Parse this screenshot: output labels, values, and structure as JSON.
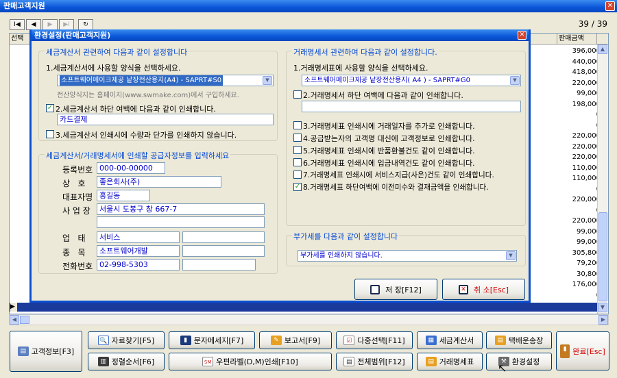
{
  "window": {
    "title": "판매고객지원",
    "close": "✕"
  },
  "nav": {
    "first": "I◀",
    "prev": "◀",
    "next": "▶",
    "last": "▶I",
    "refresh": "↻",
    "count": "39 / 39"
  },
  "grid": {
    "headers": [
      "선택",
      "판매금액"
    ],
    "amounts": [
      "396,000",
      "440,000",
      "418,000",
      "220,000",
      "99,000",
      "198,000",
      "0",
      "0",
      "220,000",
      "220,000",
      "220,000",
      "110,000",
      "110,000",
      "0",
      "220,000",
      "0",
      "220,000",
      "99,000",
      "99,000",
      "305,800",
      "79,200",
      "30,800",
      "176,000",
      "0",
      "99,000"
    ],
    "row_arrow": "▶"
  },
  "dialog": {
    "title": "환경설정(판매고객지원)",
    "close": "✕",
    "tax": {
      "group_title": "세금계산서 관련하여 다음과 같이 설정합니다",
      "q1": "1.세금계산서에 사용할 양식을 선택하세요.",
      "q1_value": "소프트웨어메이크제공 낱장전산용지(A4)      - SAPRT#S0",
      "q1_note": "전산양식지는 홈페이지(www.swmake.com)에서 구입하세요.",
      "q2": "2.세금계산서 하단 여백에 다음과 같이 인쇄합니다.",
      "q2_checked": true,
      "q2_value": "카드결제",
      "q3": "3.세금계산서 인쇄시에 수량과 단가를 인쇄하지 않습니다.",
      "q3_checked": false
    },
    "supplier": {
      "group_title": "세금계산서/거래명세서에 인쇄할 공급자정보를 입력하세요",
      "reg_label": "등록번호",
      "reg_value": "000-00-00000",
      "name_label": "상   호",
      "name_value": "좋은회사(주)",
      "rep_label": "대표자명",
      "rep_value": "홍길동",
      "addr_label": "사 업 장",
      "addr_value": "서울시 도봉구 창 667-7",
      "biz_label": "업   태",
      "biz_value": "서비스",
      "item_label": "종   목",
      "item_value": "소프트웨어개발",
      "tel_label": "전화번호",
      "tel_value": "02-998-5303"
    },
    "stmt": {
      "group_title": "거래명세서 관련하여 다음과 같이 설정합니다.",
      "q1": "1.거래명세표에 사용할 양식을 선택하세요.",
      "q1_value": "소프트웨어메이크제공 낱장전산용지( A4 )   - SAPRT#G0",
      "q2": "2.거래명세서 하단 여백에 다음과 같이 인쇄합니다.",
      "q2_value": "",
      "options": [
        {
          "label": "3.거래명세표 인쇄시에 거래일자를 추가로 인쇄합니다.",
          "checked": false
        },
        {
          "label": "4.공급받는자의 고객명 대신에 고객정보로 인쇄합니다.",
          "checked": false
        },
        {
          "label": "5.거래명세표 인쇄시에 반품환불건도 같이 인쇄합니다.",
          "checked": false
        },
        {
          "label": "6.거래명세표 인쇄시에 입금내역건도 같이 인쇄합니다.",
          "checked": false
        },
        {
          "label": "7.거래명세표 인쇄시에 서비스지급(사은)건도 같이 인쇄합니다.",
          "checked": false
        },
        {
          "label": "8.거래명세표 하단여백에 이전미수와 결재금액을 인쇄합니다.",
          "checked": true
        }
      ]
    },
    "vat": {
      "group_title": "부가세를 다음과 같이 설정합니다",
      "value": "부가세를 인쇄하지 않습니다."
    },
    "save_label": "저 장[F12]",
    "cancel_label": "취 소[Esc]"
  },
  "buttons": {
    "customer": "고객정보[F3]",
    "search": "자료찾기[F5]",
    "sms": "문자메세지[F7]",
    "report": "보고서[F9]",
    "multi": "다중선택[F11]",
    "tax_invoice": "세금계산서",
    "delivery": "택배운송장",
    "sort": "정렬순서[F6]",
    "postal": "우편라벨(D,M)인쇄[F10]",
    "range": "전체범위[F12]",
    "statement": "거래명세표",
    "settings": "환경설정",
    "exit": "완료[Esc]"
  },
  "colors": {
    "title_bar": "#0a56d8",
    "group_title": "#0046d5",
    "selection": "#1a3a9c",
    "exit_text": "#d40000"
  }
}
